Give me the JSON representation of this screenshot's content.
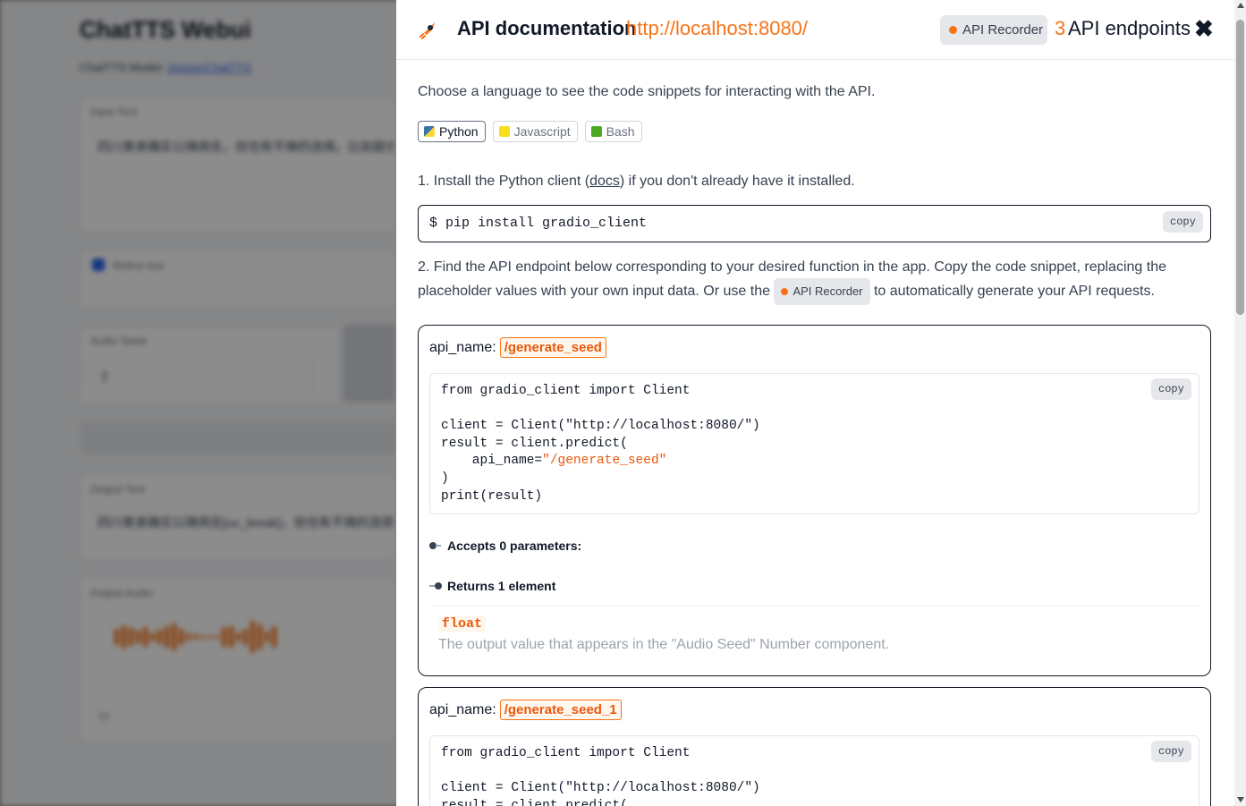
{
  "background": {
    "title": "ChatTTS Webui",
    "subtitle_prefix": "ChatTTS Model:",
    "subtitle_link": "2noise/ChatTTS",
    "input_label": "Input Text",
    "input_text": "四川美食确实以辣闻名，但也有不辣的选择。比如甜水面、赖汤圆、蛋烘糕",
    "refine_label": "Refine text",
    "audio_seed_label": "Audio Seed",
    "audio_seed_value": "2",
    "output_label": "Output Text",
    "output_text": "四川美食确实以辣闻名[uv_break]，但也有不辣的选择[uv_break]",
    "audio_label": "Output Audio",
    "speed_label": "1x"
  },
  "panel": {
    "title": "API documentation",
    "url": "http://localhost:8080/",
    "recorder_label": "API Recorder",
    "endpoints_count": "3",
    "endpoints_label": "API endpoints",
    "close_symbol": "✖",
    "intro": "Choose a language to see the code snippets for interacting with the API.",
    "languages": [
      {
        "label": "Python",
        "icon": "python-icon",
        "color": "#3776ab"
      },
      {
        "label": "Javascript",
        "icon": "javascript-icon",
        "color": "#f7df1e"
      },
      {
        "label": "Bash",
        "icon": "bash-icon",
        "color": "#4eaa25"
      }
    ],
    "step1_prefix": "1. Install the Python client (",
    "step1_link": "docs",
    "step1_suffix": ") if you don't already have it installed.",
    "install_command": "$ pip install gradio_client",
    "copy_label": "copy",
    "step2_prefix": "2. Find the API endpoint below corresponding to your desired function in the app. Copy the code snippet, replacing the placeholder values with your own input data. Or use the",
    "step2_suffix": "to automatically generate your API requests.",
    "endpoints": [
      {
        "api_name_label": "api_name:",
        "api_name": "/generate_seed",
        "code_line1": "from gradio_client import Client",
        "code_line2": "client = Client(\"http://localhost:8080/\")",
        "code_line3": "result = client.predict(",
        "code_line4_prefix": "    api_name=",
        "code_line4_value": "\"/generate_seed\"",
        "code_line5": ")",
        "code_line6": "print(result)",
        "accepts": "Accepts 0 parameters:",
        "returns": "Returns 1 element",
        "return_type": "float",
        "return_desc": "The output value that appears in the \"Audio Seed\" Number component."
      },
      {
        "api_name_label": "api_name:",
        "api_name": "/generate_seed_1",
        "code_line1": "from gradio_client import Client",
        "code_line2": "client = Client(\"http://localhost:8080/\")",
        "code_line3": "result = client.predict("
      }
    ]
  }
}
